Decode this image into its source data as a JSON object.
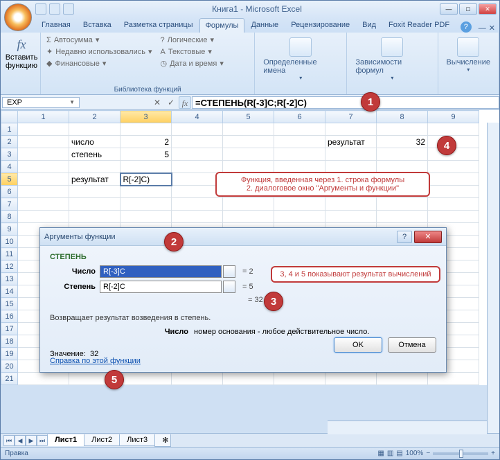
{
  "window": {
    "title": "Книга1 - Microsoft Excel"
  },
  "tabs": {
    "items": [
      "Главная",
      "Вставка",
      "Разметка страницы",
      "Формулы",
      "Данные",
      "Рецензирование",
      "Вид",
      "Foxit Reader PDF"
    ],
    "active": 3
  },
  "ribbon": {
    "insert_fn": "Вставить функцию",
    "library_label": "Библиотека функций",
    "lib": {
      "autosum": "Автосумма",
      "recent": "Недавно использовались",
      "financial": "Финансовые",
      "logical": "Логические",
      "text": "Текстовые",
      "datetime": "Дата и время"
    },
    "names": "Определенные имена",
    "deps": "Зависимости формул",
    "calc": "Вычисление"
  },
  "namebox": "EXP",
  "formula": "=СТЕПЕНЬ(R[-3]C;R[-2]C)",
  "columns": [
    "1",
    "2",
    "3",
    "4",
    "5",
    "6",
    "7",
    "8",
    "9"
  ],
  "rows": [
    "1",
    "2",
    "3",
    "4",
    "5",
    "6",
    "7",
    "8",
    "9",
    "10",
    "11",
    "12",
    "13",
    "14",
    "15",
    "16",
    "17",
    "18",
    "19",
    "20",
    "21"
  ],
  "cells": {
    "r2c2": "число",
    "r2c3": "2",
    "r3c2": "степень",
    "r3c3": "5",
    "r5c2": "результат",
    "r5c3": "R[-2]C)",
    "r2c7": "результат",
    "r2c8": "32"
  },
  "callout_note1_l1": "Функция, введенная через 1. строка формулы",
  "callout_note1_l2": "2. диалоговое окно \"Аргументы и функции\"",
  "callout_note2": "3, 4 и 5 показывают результат вычислений",
  "dialog": {
    "title": "Аргументы функции",
    "fname": "СТЕПЕНЬ",
    "arg1_label": "Число",
    "arg1_val": "R[-3]C",
    "arg1_res": "= 2",
    "arg2_label": "Степень",
    "arg2_val": "R[-2]C",
    "arg2_res": "= 5",
    "result_eq": "= 32",
    "desc": "Возвращает результат возведения в степень.",
    "argdesc_label": "Число",
    "argdesc_text": "номер основания - любое действительное число.",
    "value_label": "Значение:",
    "value": "32",
    "help_link": "Справка по этой функции",
    "ok": "OK",
    "cancel": "Отмена"
  },
  "sheets": {
    "items": [
      "Лист1",
      "Лист2",
      "Лист3"
    ],
    "active": 0
  },
  "status": {
    "mode": "Правка",
    "zoom": "100%"
  }
}
